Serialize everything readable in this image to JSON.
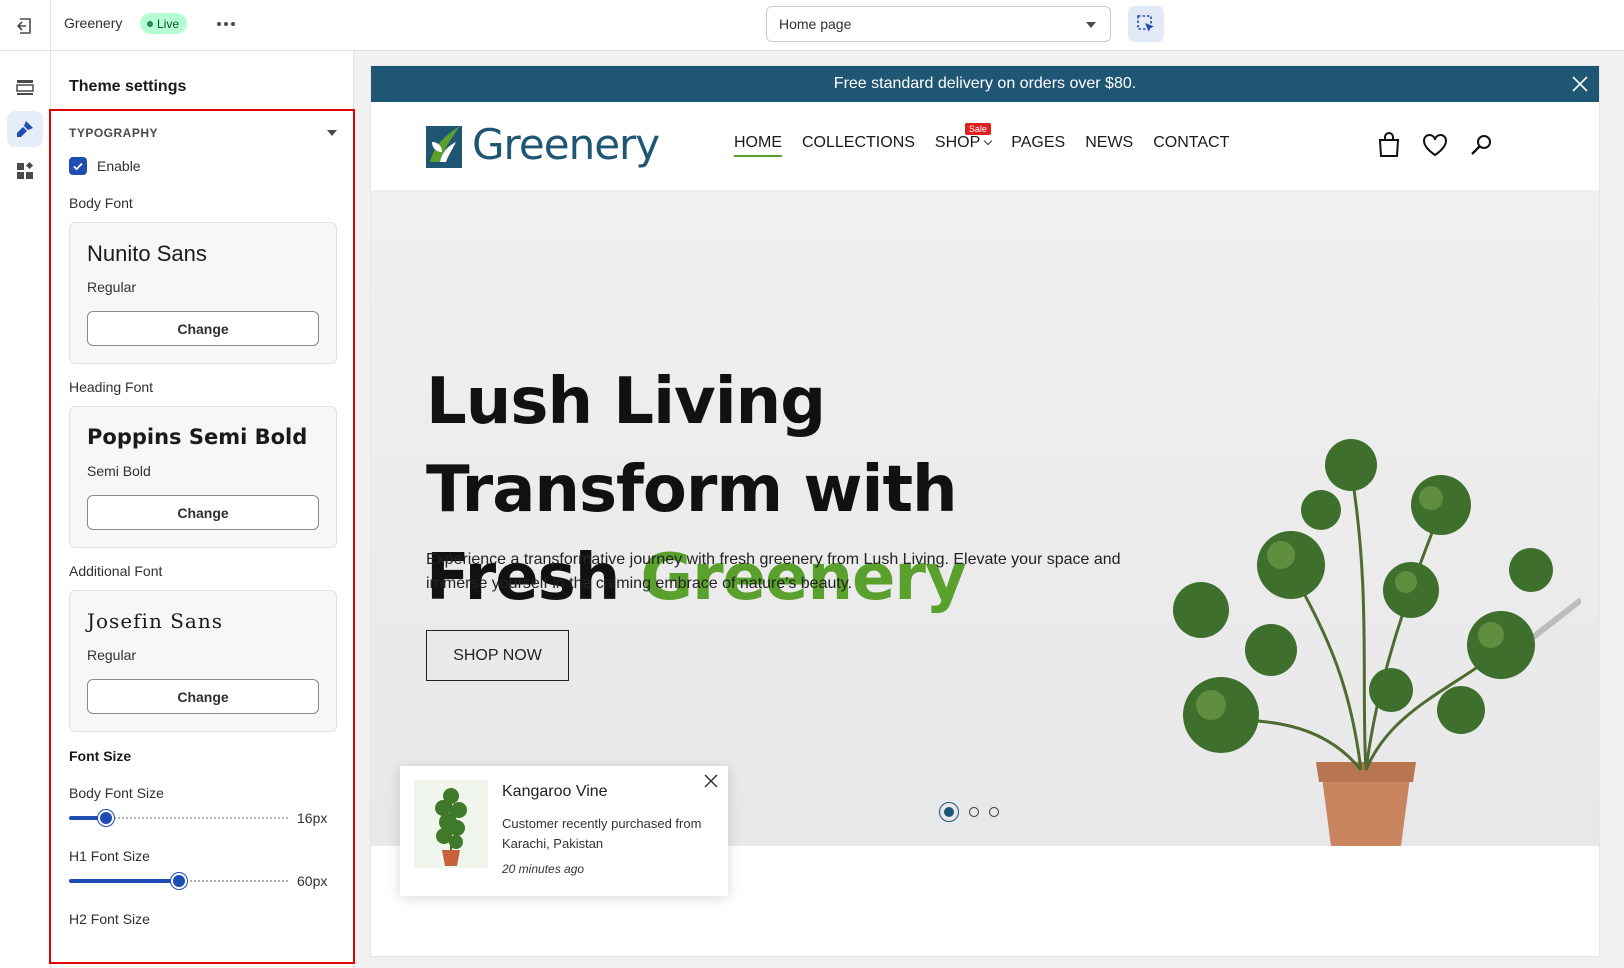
{
  "topbar": {
    "store_name": "Greenery",
    "live_label": "Live",
    "page_select_value": "Home page"
  },
  "panel": {
    "title": "Theme settings",
    "section_title": "TYPOGRAPHY",
    "enable_label": "Enable",
    "enable_checked": true,
    "body_font": {
      "label": "Body Font",
      "name": "Nunito Sans",
      "style": "Regular",
      "change": "Change"
    },
    "heading_font": {
      "label": "Heading Font",
      "name": "Poppins Semi Bold",
      "style": "Semi Bold",
      "change": "Change"
    },
    "additional_font": {
      "label": "Additional Font",
      "name": "Josefin Sans",
      "style": "Regular",
      "change": "Change"
    },
    "font_size_title": "Font Size",
    "body_font_size": {
      "label": "Body Font Size",
      "value": "16px",
      "level": 0.17
    },
    "h1_font_size": {
      "label": "H1 Font Size",
      "value": "60px",
      "level": 0.5
    },
    "h2_font_size": {
      "label": "H2 Font Size"
    }
  },
  "preview": {
    "announcement": "Free standard delivery on orders over $80.",
    "logo_text": "Greenery",
    "nav": [
      "HOME",
      "COLLECTIONS",
      "SHOP",
      "PAGES",
      "NEWS",
      "CONTACT"
    ],
    "sale_badge": "Sale",
    "hero": {
      "headline_part1": "Lush Living Transform with Fresh ",
      "headline_accent": "Greenery",
      "description": "Experience a transformative journey with fresh greenery from Lush Living. Elevate your space and immerse yourself in the calming embrace of nature's beauty.",
      "cta": "SHOP NOW",
      "slide_count": 3,
      "active_slide": 1
    },
    "toast": {
      "title": "Kangaroo Vine",
      "message": "Customer recently purchased  from Karachi, Pakistan",
      "time_ago": "20 minutes ago"
    }
  },
  "colors": {
    "brand_blue": "#1e5674",
    "accent_green": "#5aa02c",
    "admin_blue": "#1f4cb5",
    "highlight_red": "#e00000"
  }
}
